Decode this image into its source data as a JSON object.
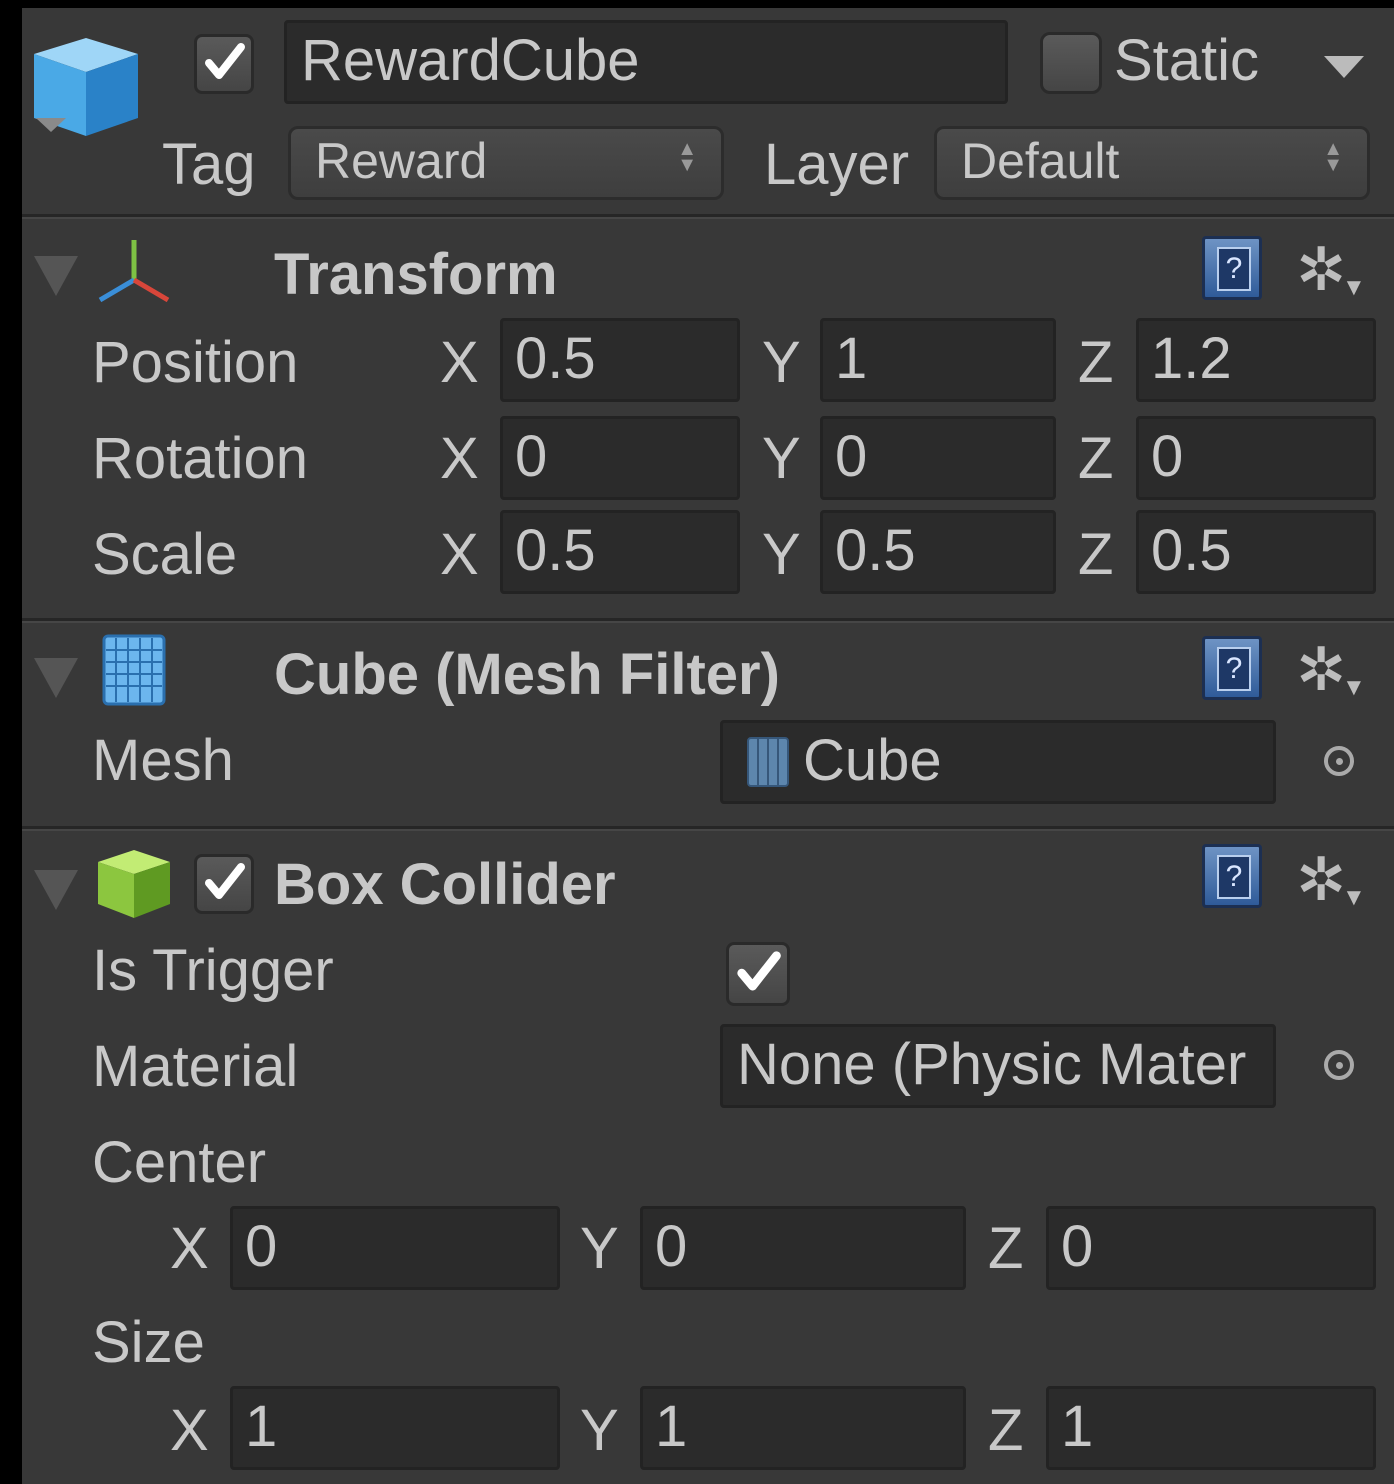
{
  "header": {
    "active": true,
    "name": "RewardCube",
    "static_label": "Static",
    "tag_label": "Tag",
    "tag_value": "Reward",
    "layer_label": "Layer",
    "layer_value": "Default"
  },
  "transform": {
    "title": "Transform",
    "rows": [
      {
        "label": "Position",
        "x": "0.5",
        "y": "1",
        "z": "1.2"
      },
      {
        "label": "Rotation",
        "x": "0",
        "y": "0",
        "z": "0"
      },
      {
        "label": "Scale",
        "x": "0.5",
        "y": "0.5",
        "z": "0.5"
      }
    ],
    "axis": {
      "x": "X",
      "y": "Y",
      "z": "Z"
    }
  },
  "mesh_filter": {
    "title": "Cube (Mesh Filter)",
    "mesh_label": "Mesh",
    "mesh_value": "Cube"
  },
  "box_collider": {
    "title": "Box Collider",
    "enabled": true,
    "is_trigger_label": "Is Trigger",
    "is_trigger": true,
    "material_label": "Material",
    "material_value": "None (Physic Mater",
    "center_label": "Center",
    "center": {
      "x": "0",
      "y": "0",
      "z": "0"
    },
    "size_label": "Size",
    "size": {
      "x": "1",
      "y": "1",
      "z": "1"
    }
  },
  "icons": [
    "cube-icon",
    "checkbox",
    "dropdown-arrow-icon",
    "transform-axes-icon",
    "help-icon",
    "gear-icon",
    "mesh-filter-icon",
    "object-picker-icon",
    "box-collider-icon"
  ],
  "colors": {
    "panel_bg": "#383838",
    "field_bg": "#2b2b2b",
    "text": "#c8c8c8"
  }
}
